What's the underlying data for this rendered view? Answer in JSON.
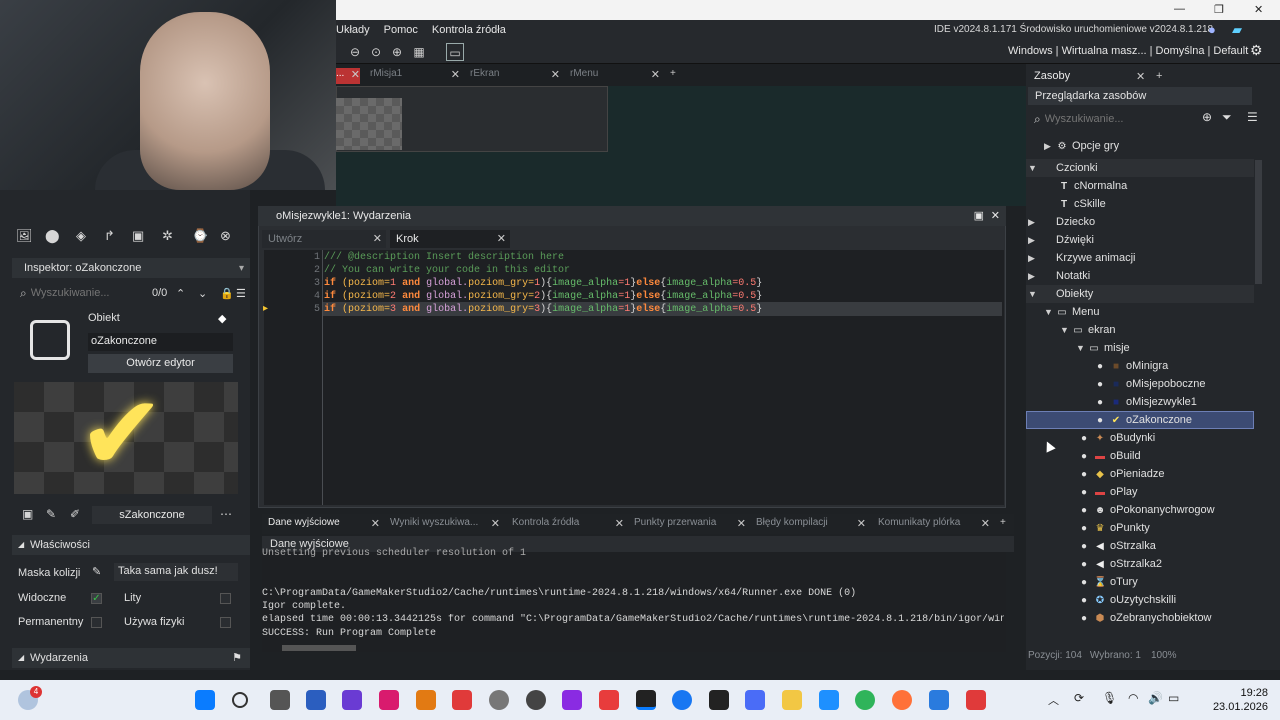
{
  "window": {
    "title_right": "IDE v2024.8.1.171  Środowisko uruchomieniowe v2024.8.1.218",
    "targets": "Windows | Wirtualna masz... | Domyślna | Default"
  },
  "menu": [
    "Układy",
    "Pomoc",
    "Kontrola źródła"
  ],
  "workspace_tabs": [
    "...",
    "rMisja1",
    "rEkran",
    "rMenu"
  ],
  "inspector": {
    "title": "Inspektor: oZakonczone",
    "search_placeholder": "Wyszukiwanie...",
    "count": "0/0",
    "object_label": "Obiekt",
    "object_name": "oZakonczone",
    "open_editor": "Otwórz edytor",
    "sprite_name": "sZakonczone",
    "section_properties": "Właściwości",
    "mask_label": "Maska kolizji",
    "mask_value": "Taka sama jak dusz!",
    "visible_label": "Widoczne",
    "solid_label": "Lity",
    "persistent_label": "Permanentny",
    "physics_label": "Używa fizyki",
    "section_events": "Wydarzenia"
  },
  "code_window": {
    "title": "oMisjezwykle1: Wydarzenia",
    "tabs": [
      {
        "label": "Utwórz"
      },
      {
        "label": "Krok"
      }
    ],
    "line_numbers": [
      "1",
      "2",
      "3",
      "4",
      "5"
    ],
    "comment1": "/// @description Insert description here",
    "comment2": "// You can write your code in this editor",
    "lines": [
      {
        "n1": "1",
        "n2": "1"
      },
      {
        "n1": "2",
        "n2": "2"
      },
      {
        "n1": "3",
        "n2": "3"
      }
    ],
    "kw_if": "if",
    "kw_and": "and",
    "kw_else": "else",
    "var_poziom": "(poziom=",
    "var_global": "global.",
    "var_pg": "poziom_gry=",
    "fn_ia": "image_alpha",
    "val_one": "=1",
    "val_half": "=0.5"
  },
  "output": {
    "tabs": [
      "Dane wyjściowe",
      "Wyniki wyszukiwa...",
      "Kontrola źródła",
      "Punkty przerwania",
      "Błędy kompilacji",
      "Komunikaty plórka"
    ],
    "header": "Dane wyjściowe",
    "lines": [
      "Unsetting previous scheduler resolution of 1",
      "",
      "C:\\ProgramData/GameMakerStudio2/Cache/runtimes\\runtime-2024.8.1.218/windows/x64/Runner.exe DONE (0)",
      "Igor complete.",
      "elapsed time 00:00:13.3442125s for command \"C:\\ProgramData/GameMakerStudio2/Cache/runtimes\\runtime-2024.8.1.218/bin/igor/win",
      "SUCCESS: Run Program Complete"
    ]
  },
  "assets": {
    "tab_label": "Zasoby",
    "title": "Przeglądarka zasobów",
    "search_placeholder": "Wyszukiwanie...",
    "items": [
      {
        "label": "Opcje gry"
      },
      {
        "label": "Czcionki"
      },
      {
        "label": "cNormalna"
      },
      {
        "label": "cSkille"
      },
      {
        "label": "Dziecko"
      },
      {
        "label": "Dźwięki"
      },
      {
        "label": "Krzywe animacji"
      },
      {
        "label": "Notatki"
      },
      {
        "label": "Obiekty"
      },
      {
        "label": "Menu"
      },
      {
        "label": "ekran"
      },
      {
        "label": "misje"
      },
      {
        "label": "oMinigra"
      },
      {
        "label": "oMisjepoboczne"
      },
      {
        "label": "oMisjezwykle1"
      },
      {
        "label": "oZakonczone"
      },
      {
        "label": "oBudynki"
      },
      {
        "label": "oBuild"
      },
      {
        "label": "oPieniadze"
      },
      {
        "label": "oPlay"
      },
      {
        "label": "oPokonanychwrogow"
      },
      {
        "label": "oPunkty"
      },
      {
        "label": "oStrzalka"
      },
      {
        "label": "oStrzalka2"
      },
      {
        "label": "oTury"
      },
      {
        "label": "oUzytychskilli"
      },
      {
        "label": "oZebranychobiektow"
      }
    ],
    "status_pos": "Pozycji: 104",
    "status_sel": "Wybrano: 1",
    "zoom": "100%"
  },
  "taskbar": {
    "time": "19:28",
    "date": "23.01.2026",
    "badge": "4"
  },
  "colors": {
    "accent": "#3c4b73",
    "check_yellow": "#ffe45a",
    "bg": "#1e2124"
  }
}
